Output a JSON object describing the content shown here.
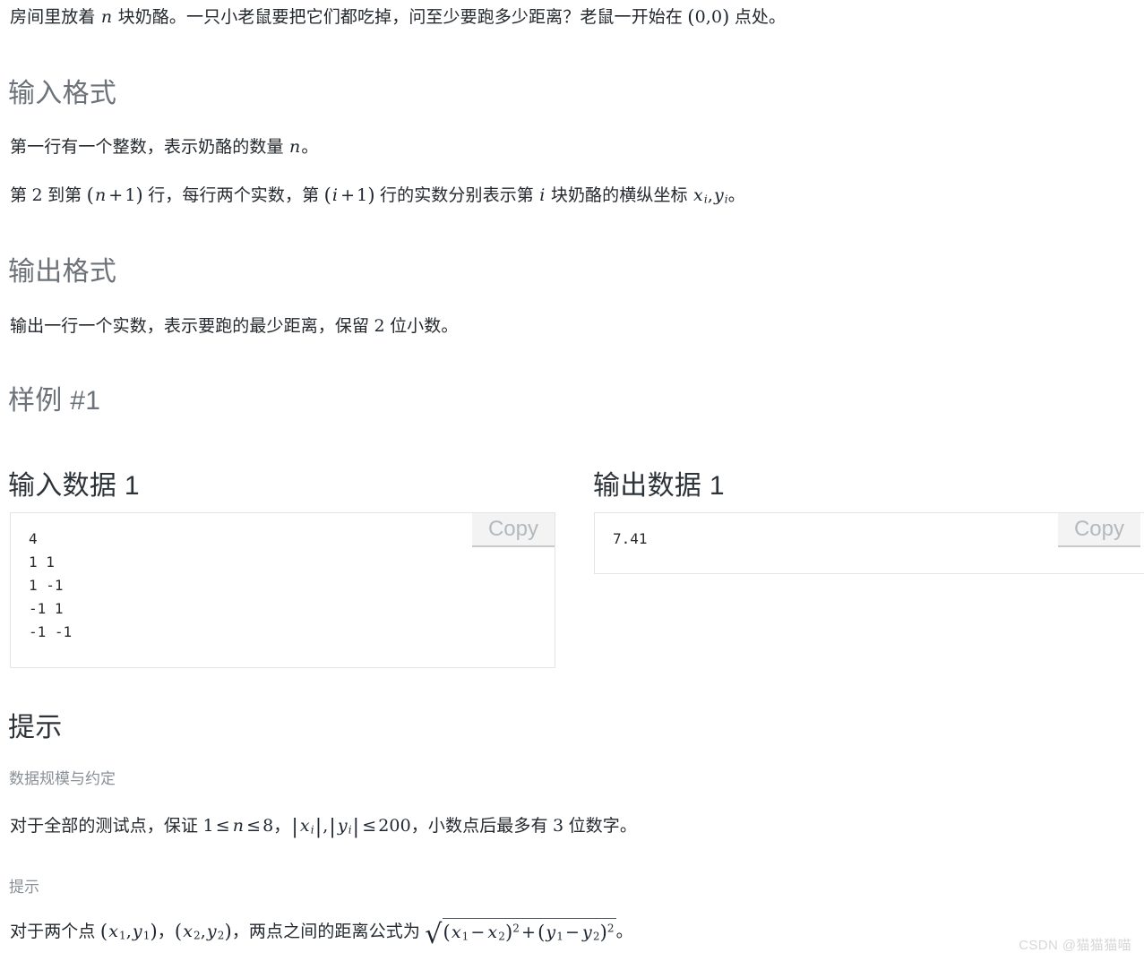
{
  "intro": {
    "text_a": "房间里放着 ",
    "var_n": "n",
    "text_b": " 块奶酪。一只小老鼠要把它们都吃掉，问至少要跑多少距离？老鼠一开始在 ",
    "point_open": "(",
    "point_x": "0",
    "point_comma": ",",
    "point_y": "0",
    "point_close": ")",
    "text_c": " 点处。"
  },
  "input_format": {
    "heading": "输入格式",
    "line1_a": "第一行有一个整数，表示奶酪的数量 ",
    "line1_var": "n",
    "line1_b": "。",
    "line2_a": "第 ",
    "line2_num2": "2",
    "line2_b": " 到第 ",
    "line2_expr1_open": "(",
    "line2_expr1_var": "n",
    "line2_expr1_plus": "+",
    "line2_expr1_one": "1",
    "line2_expr1_close": ")",
    "line2_c": " 行，每行两个实数，第 ",
    "line2_expr2_open": "(",
    "line2_expr2_var": "i",
    "line2_expr2_plus": "+",
    "line2_expr2_one": "1",
    "line2_expr2_close": ")",
    "line2_d": " 行的实数分别表示第 ",
    "line2_var_i": "i",
    "line2_e": " 块奶酪的横纵坐标 ",
    "line2_x": "x",
    "line2_x_sub": "i",
    "line2_comma": ",",
    "line2_y": "y",
    "line2_y_sub": "i",
    "line2_f": "。"
  },
  "output_format": {
    "heading": "输出格式",
    "line1_a": "输出一行一个实数，表示要跑的最少距离，保留 ",
    "line1_num": "2",
    "line1_b": " 位小数。"
  },
  "sample": {
    "heading_prefix": "样例",
    "heading_suffix": "#1",
    "input": {
      "title": "输入数据 1",
      "copy_label": "Copy",
      "content": "4\n1 1\n1 -1\n-1 1\n-1 -1"
    },
    "output": {
      "title": "输出数据 1",
      "copy_label": "Copy",
      "content": "7.41"
    }
  },
  "hint": {
    "heading": "提示",
    "block1": {
      "label": "数据规模与约定",
      "text_a": "对于全部的测试点，保证 ",
      "n_low": "1",
      "le1": "≤",
      "n_var": "n",
      "le2": "≤",
      "n_high": "8",
      "text_b": "，",
      "abs_open1": "|",
      "abs_x": "x",
      "abs_x_sub": "i",
      "abs_close1": "|",
      "abs_comma": ",",
      "abs_open2": "|",
      "abs_y": "y",
      "abs_y_sub": "i",
      "abs_close2": "|",
      "le3": "≤",
      "limit": "200",
      "text_c": "，小数点后最多有 ",
      "digits": "3",
      "text_d": " 位数字。"
    },
    "block2": {
      "label": "提示",
      "text_a": "对于两个点 ",
      "p1_open": "(",
      "p1_x": "x",
      "p1_x_sub": "1",
      "p1_comma": ",",
      "p1_y": "y",
      "p1_y_sub": "1",
      "p1_close": ")",
      "text_b": "，",
      "p2_open": "(",
      "p2_x": "x",
      "p2_x_sub": "2",
      "p2_comma": ",",
      "p2_y": "y",
      "p2_y_sub": "2",
      "p2_close": ")",
      "text_c": "，两点之间的距离公式为 ",
      "formula": {
        "radical_sign": "√",
        "open1": "(",
        "x1": "x",
        "x1_sub": "1",
        "minus1": "−",
        "x2": "x",
        "x2_sub": "2",
        "close1": ")",
        "exp1": "2",
        "plus": "+",
        "open2": "(",
        "y1": "y",
        "y1_sub": "1",
        "minus2": "−",
        "y2": "y",
        "y2_sub": "2",
        "close2": ")",
        "exp2": "2"
      },
      "text_d": "。"
    }
  },
  "watermark": {
    "text": "CSDN @猫猫猫喵"
  },
  "colors": {
    "page_bg": "#ffffff",
    "body_text": "#24292e",
    "heading_gray": "#6c7279",
    "heading_dark": "#2c3338",
    "sublabel_gray": "#8a9097",
    "box_border": "#e2e4e6",
    "copy_bg": "#f3f3f3",
    "copy_text": "#b4b9bd",
    "watermark": "#d7d7d7"
  }
}
